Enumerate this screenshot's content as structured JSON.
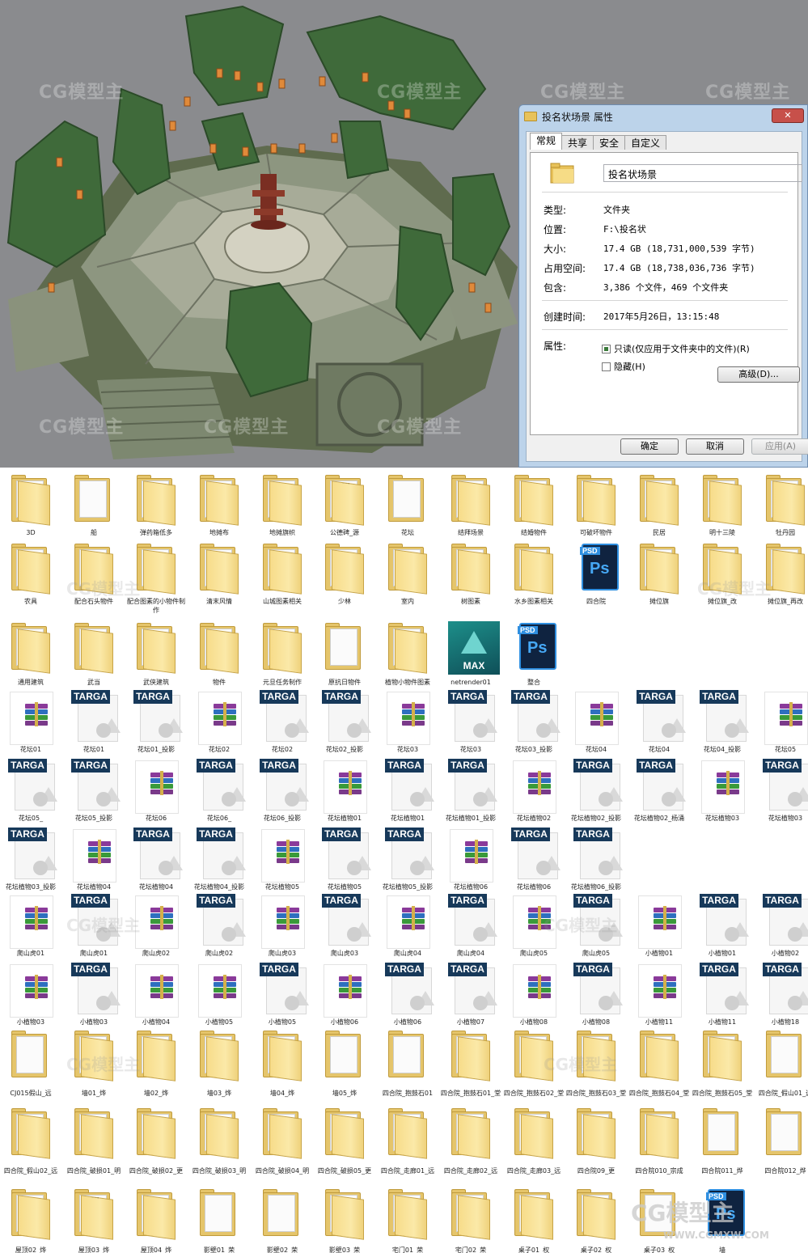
{
  "viewport": {
    "watermarks": [
      "CG模型主",
      "CG模型主",
      "CG模型主",
      "CG模型主",
      "CG模型主",
      "CG模型主",
      "CG模型主"
    ]
  },
  "dialog": {
    "title": "投名状场景 属性",
    "close_label": "✕",
    "tabs": [
      "常规",
      "共享",
      "安全",
      "自定义"
    ],
    "folder_name": "投名状场景",
    "fields": [
      {
        "key": "类型:",
        "value": "文件夹"
      },
      {
        "key": "位置:",
        "value": "F:\\投名状"
      },
      {
        "key": "大小:",
        "value": "17.4 GB (18,731,000,539 字节)"
      },
      {
        "key": "占用空间:",
        "value": "17.4 GB (18,738,036,736 字节)"
      },
      {
        "key": "包含:",
        "value": "3,386 个文件，469 个文件夹"
      },
      {
        "key": "创建时间:",
        "value": "2017年5月26日，13:15:48"
      }
    ],
    "attributes_label": "属性:",
    "readonly_label": "只读(仅应用于文件夹中的文件)(R)",
    "hidden_label": "隐藏(H)",
    "advanced_label": "高级(D)...",
    "ok_label": "确定",
    "cancel_label": "取消",
    "apply_label": "应用(A)"
  },
  "grid_watermark": "CG模型主",
  "bottom_watermark": "CG模型主",
  "bottom_watermark_sub": "WWW.CGMXW.COM",
  "files": [
    [
      {
        "type": "folder-green",
        "name": "3D"
      },
      {
        "type": "folder-plain",
        "name": "船"
      },
      {
        "type": "folder",
        "name": "弹药箱低多"
      },
      {
        "type": "folder",
        "name": "地摊布"
      },
      {
        "type": "folder",
        "name": "地摊旗帜"
      },
      {
        "type": "folder-blue",
        "name": "公德碑_源"
      },
      {
        "type": "folder-plain",
        "name": "花坛"
      },
      {
        "type": "folder",
        "name": "结拜场景"
      },
      {
        "type": "folder",
        "name": "结婚物件"
      },
      {
        "type": "folder",
        "name": "可破坏物件"
      },
      {
        "type": "folder",
        "name": "民居"
      },
      {
        "type": "folder",
        "name": "明十三陵"
      },
      {
        "type": "folder",
        "name": "牡丹园"
      }
    ],
    [
      {
        "type": "folder",
        "name": "农具"
      },
      {
        "type": "folder-dark",
        "name": "配合石头物件"
      },
      {
        "type": "folder",
        "name": "配合图素的小物件制作"
      },
      {
        "type": "folder",
        "name": "清末风情"
      },
      {
        "type": "folder",
        "name": "山城图素相关"
      },
      {
        "type": "folder",
        "name": "少林"
      },
      {
        "type": "folder",
        "name": "室内"
      },
      {
        "type": "folder",
        "name": "树图素"
      },
      {
        "type": "folder",
        "name": "水乡图素相关"
      },
      {
        "type": "psd",
        "name": "四合院"
      },
      {
        "type": "folder",
        "name": "摊位旗"
      },
      {
        "type": "folder",
        "name": "摊位旗_改"
      },
      {
        "type": "folder",
        "name": "摊位旗_再改"
      }
    ],
    [
      {
        "type": "folder",
        "name": "通用建筑"
      },
      {
        "type": "folder",
        "name": "武当"
      },
      {
        "type": "folder",
        "name": "武侠建筑"
      },
      {
        "type": "folder",
        "name": "物件"
      },
      {
        "type": "folder",
        "name": "元旦任务制作"
      },
      {
        "type": "folder-plain",
        "name": "原抗日物件"
      },
      {
        "type": "folder",
        "name": "植物小物件图素"
      },
      {
        "type": "max",
        "name": "netrender01"
      },
      {
        "type": "psd",
        "name": "整合"
      }
    ],
    [
      {
        "type": "rar",
        "name": "花坛01"
      },
      {
        "type": "tga",
        "name": "花坛01"
      },
      {
        "type": "tga",
        "name": "花坛01_投影"
      },
      {
        "type": "rar",
        "name": "花坛02"
      },
      {
        "type": "tga",
        "name": "花坛02"
      },
      {
        "type": "tga",
        "name": "花坛02_投影"
      },
      {
        "type": "rar",
        "name": "花坛03"
      },
      {
        "type": "tga",
        "name": "花坛03"
      },
      {
        "type": "tga",
        "name": "花坛03_投影"
      },
      {
        "type": "rar",
        "name": "花坛04"
      },
      {
        "type": "tga",
        "name": "花坛04"
      },
      {
        "type": "tga",
        "name": "花坛04_投影"
      },
      {
        "type": "rar",
        "name": "花坛05"
      }
    ],
    [
      {
        "type": "tga",
        "name": "花坛05_"
      },
      {
        "type": "tga",
        "name": "花坛05_投影"
      },
      {
        "type": "rar",
        "name": "花坛06"
      },
      {
        "type": "tga",
        "name": "花坛06_"
      },
      {
        "type": "tga",
        "name": "花坛06_投影"
      },
      {
        "type": "rar",
        "name": "花坛植物01"
      },
      {
        "type": "tga",
        "name": "花坛植物01"
      },
      {
        "type": "tga",
        "name": "花坛植物01_投影"
      },
      {
        "type": "rar",
        "name": "花坛植物02"
      },
      {
        "type": "tga",
        "name": "花坛植物02_投影"
      },
      {
        "type": "tga",
        "name": "花坛植物02_杨涌"
      },
      {
        "type": "rar",
        "name": "花坛植物03"
      },
      {
        "type": "tga",
        "name": "花坛植物03"
      }
    ],
    [
      {
        "type": "tga",
        "name": "花坛植物03_投影"
      },
      {
        "type": "rar",
        "name": "花坛植物04"
      },
      {
        "type": "tga",
        "name": "花坛植物04"
      },
      {
        "type": "tga",
        "name": "花坛植物04_投影"
      },
      {
        "type": "rar",
        "name": "花坛植物05"
      },
      {
        "type": "tga",
        "name": "花坛植物05"
      },
      {
        "type": "tga",
        "name": "花坛植物05_投影"
      },
      {
        "type": "rar",
        "name": "花坛植物06"
      },
      {
        "type": "tga",
        "name": "花坛植物06"
      },
      {
        "type": "tga",
        "name": "花坛植物06_投影"
      }
    ],
    [
      {
        "type": "rar",
        "name": "爬山虎01"
      },
      {
        "type": "tga",
        "name": "爬山虎01"
      },
      {
        "type": "rar",
        "name": "爬山虎02"
      },
      {
        "type": "tga",
        "name": "爬山虎02"
      },
      {
        "type": "rar",
        "name": "爬山虎03"
      },
      {
        "type": "tga",
        "name": "爬山虎03"
      },
      {
        "type": "rar",
        "name": "爬山虎04"
      },
      {
        "type": "tga",
        "name": "爬山虎04"
      },
      {
        "type": "rar",
        "name": "爬山虎05"
      },
      {
        "type": "tga",
        "name": "爬山虎05"
      },
      {
        "type": "rar",
        "name": "小植物01"
      },
      {
        "type": "tga",
        "name": "小植物01"
      },
      {
        "type": "tga",
        "name": "小植物02"
      }
    ],
    [
      {
        "type": "rar",
        "name": "小植物03"
      },
      {
        "type": "tga",
        "name": "小植物03"
      },
      {
        "type": "rar",
        "name": "小植物04"
      },
      {
        "type": "rar",
        "name": "小植物05"
      },
      {
        "type": "tga",
        "name": "小植物05"
      },
      {
        "type": "rar",
        "name": "小植物06"
      },
      {
        "type": "tga",
        "name": "小植物06"
      },
      {
        "type": "tga",
        "name": "小植物07"
      },
      {
        "type": "rar",
        "name": "小植物08"
      },
      {
        "type": "tga",
        "name": "小植物08"
      },
      {
        "type": "rar",
        "name": "小植物11"
      },
      {
        "type": "tga",
        "name": "小植物11"
      },
      {
        "type": "tga",
        "name": "小植物18"
      }
    ],
    [
      {
        "type": "folder-plain",
        "name": "CJ015假山_远"
      },
      {
        "type": "folder-dark",
        "name": "墙01_烨"
      },
      {
        "type": "folder-dark",
        "name": "墙02_烨"
      },
      {
        "type": "folder-dark",
        "name": "墙03_烨"
      },
      {
        "type": "folder-dark",
        "name": "墙04_烨"
      },
      {
        "type": "folder-plain",
        "name": "墙05_烨"
      },
      {
        "type": "folder-plain",
        "name": "四合院_抱鼓石01"
      },
      {
        "type": "folder-dark",
        "name": "四合院_抱鼓石01_堂"
      },
      {
        "type": "folder-dark",
        "name": "四合院_抱鼓石02_堂"
      },
      {
        "type": "folder-dark",
        "name": "四合院_抱鼓石03_堂"
      },
      {
        "type": "folder-dark",
        "name": "四合院_抱鼓石04_堂"
      },
      {
        "type": "folder-dark",
        "name": "四合院_抱鼓石05_堂"
      },
      {
        "type": "folder-plain",
        "name": "四合院_假山01_远"
      }
    ],
    [
      {
        "type": "folder-dark",
        "name": "四合院_假山02_远"
      },
      {
        "type": "folder-dark",
        "name": "四合院_破损01_明"
      },
      {
        "type": "folder-dark",
        "name": "四合院_破损02_更"
      },
      {
        "type": "folder-dark",
        "name": "四合院_破损03_明"
      },
      {
        "type": "folder-dark",
        "name": "四合院_破损04_明"
      },
      {
        "type": "folder-dark",
        "name": "四合院_破损05_更"
      },
      {
        "type": "folder-dark",
        "name": "四合院_走廊01_远"
      },
      {
        "type": "folder-dark",
        "name": "四合院_走廊02_远"
      },
      {
        "type": "folder-dark",
        "name": "四合院_走廊03_远"
      },
      {
        "type": "folder-dark",
        "name": "四合院09_更"
      },
      {
        "type": "folder-dark",
        "name": "四合院010_宗成"
      },
      {
        "type": "folder-plain",
        "name": "四合院011_烨"
      },
      {
        "type": "folder-plain",
        "name": "四合院012_烨"
      }
    ],
    [
      {
        "type": "folder-dark",
        "name": "屋顶02_烨"
      },
      {
        "type": "folder-blue",
        "name": "屋顶03_烨"
      },
      {
        "type": "folder-dark",
        "name": "屋顶04_烨"
      },
      {
        "type": "folder-plain",
        "name": "影壁01_荣"
      },
      {
        "type": "folder-plain",
        "name": "影壁02_荣"
      },
      {
        "type": "folder-dark",
        "name": "影壁03_荣"
      },
      {
        "type": "folder-dark",
        "name": "宅门01_荣"
      },
      {
        "type": "folder-dark",
        "name": "宅门02_荣"
      },
      {
        "type": "folder-dark",
        "name": "桌子01_权"
      },
      {
        "type": "folder-dark",
        "name": "桌子02_权"
      },
      {
        "type": "folder-plain",
        "name": "桌子03_权"
      },
      {
        "type": "psd",
        "name": "墙"
      }
    ]
  ]
}
